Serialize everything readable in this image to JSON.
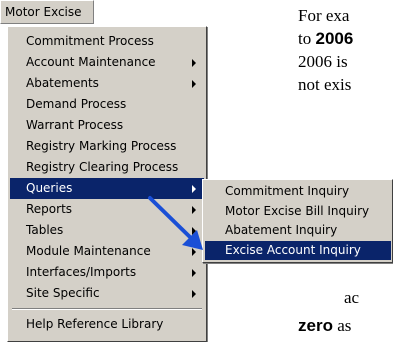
{
  "menubar": {
    "label": "Motor Excise"
  },
  "main_menu": {
    "items": [
      {
        "label": "Commitment Process",
        "submenu": false
      },
      {
        "label": "Account Maintenance",
        "submenu": true
      },
      {
        "label": "Abatements",
        "submenu": true
      },
      {
        "label": "Demand Process",
        "submenu": false
      },
      {
        "label": "Warrant Process",
        "submenu": false
      },
      {
        "label": "Registry Marking Process",
        "submenu": false
      },
      {
        "label": "Registry Clearing Process",
        "submenu": false
      },
      {
        "label": "Queries",
        "submenu": true,
        "selected": true
      },
      {
        "label": "Reports",
        "submenu": true
      },
      {
        "label": "Tables",
        "submenu": true
      },
      {
        "label": "Module Maintenance",
        "submenu": true
      },
      {
        "label": "Interfaces/Imports",
        "submenu": true
      },
      {
        "label": "Site Specific",
        "submenu": true
      }
    ],
    "footer_item": {
      "label": "Help Reference Library"
    }
  },
  "sub_menu": {
    "items": [
      {
        "label": "Commitment Inquiry"
      },
      {
        "label": "Motor Excise Bill Inquiry"
      },
      {
        "label": "Abatement Inquiry"
      },
      {
        "label": "Excise Account Inquiry",
        "selected": true
      }
    ]
  },
  "document": {
    "line1_prefix": "For exa",
    "line2_prefix": "to ",
    "line2_bold": "2006",
    "line3": "2006 is",
    "line4": "not exis",
    "line5": "ac",
    "line6_bold": "zero",
    "line6_suffix": " as"
  },
  "colors": {
    "menu_bg": "#d4d0c8",
    "highlight": "#0a246a",
    "pointer_arrow": "#1a4fd6"
  }
}
